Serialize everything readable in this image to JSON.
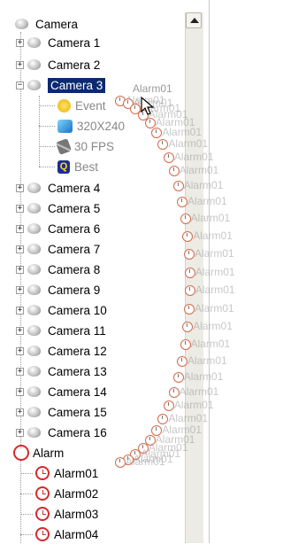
{
  "tree": {
    "root_label": "Camera",
    "cameras": [
      {
        "label": "Camera 1"
      },
      {
        "label": "Camera 2"
      },
      {
        "label": "Camera 3"
      },
      {
        "label": "Camera 4"
      },
      {
        "label": "Camera 5"
      },
      {
        "label": "Camera 6"
      },
      {
        "label": "Camera 7"
      },
      {
        "label": "Camera 8"
      },
      {
        "label": "Camera 9"
      },
      {
        "label": "Camera 10"
      },
      {
        "label": "Camera 11"
      },
      {
        "label": "Camera 12"
      },
      {
        "label": "Camera 13"
      },
      {
        "label": "Camera 14"
      },
      {
        "label": "Camera 15"
      },
      {
        "label": "Camera 16"
      }
    ],
    "camera3_children": [
      {
        "label": "Event",
        "icon": "event-icon"
      },
      {
        "label": "320X240",
        "icon": "resolution-icon"
      },
      {
        "label": "30 FPS",
        "icon": "fps-icon"
      },
      {
        "label": "Best",
        "icon": "quality-icon"
      }
    ],
    "alarm_root_label": "Alarm",
    "alarms": [
      {
        "label": "Alarm01"
      },
      {
        "label": "Alarm02"
      },
      {
        "label": "Alarm03"
      },
      {
        "label": "Alarm04"
      }
    ]
  },
  "drag": {
    "ghost_label": "Alarm01"
  },
  "colors": {
    "selection": "#0b2a6f",
    "alarm_icon": "#d42a2a",
    "drag_path": "#d76a4a"
  }
}
